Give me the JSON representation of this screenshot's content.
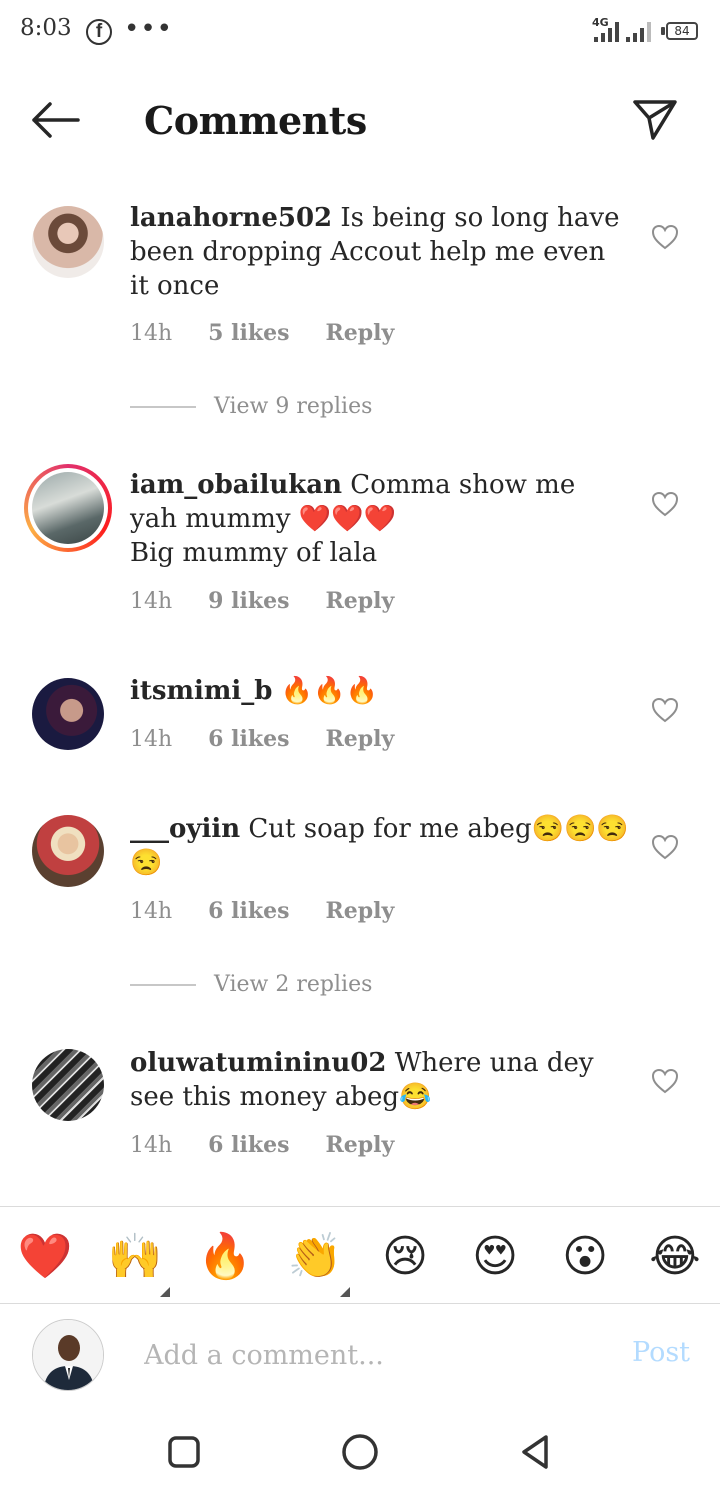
{
  "status_bar": {
    "time": "8:03",
    "network": "4G",
    "battery": "84"
  },
  "header": {
    "title": "Comments"
  },
  "comments": [
    {
      "username": "lanahorne502",
      "text": "Is being so long have been dropping Accout help me even it once",
      "time": "14h",
      "likes": "5 likes",
      "reply": "Reply",
      "view_replies": "View 9 replies"
    },
    {
      "username": "iam_obailukan",
      "text": "Comma show me yah mummy ❤️❤️❤️",
      "text2": "Big mummy of lala",
      "time": "14h",
      "likes": "9 likes",
      "reply": "Reply"
    },
    {
      "username": "itsmimi_b",
      "text": "🔥🔥🔥",
      "time": "14h",
      "likes": "6 likes",
      "reply": "Reply"
    },
    {
      "username": "___oyiin",
      "text": "Cut soap for me abeg😒😒😒😒",
      "time": "14h",
      "likes": "6 likes",
      "reply": "Reply",
      "view_replies": "View 2 replies"
    },
    {
      "username": "oluwatumininu02",
      "text": "Where una dey see this money abeg😂",
      "time": "14h",
      "likes": "6 likes",
      "reply": "Reply"
    }
  ],
  "emoji_bar": [
    "❤️",
    "🙌",
    "🔥",
    "👏",
    "😢",
    "😍",
    "😮",
    "😂"
  ],
  "input": {
    "placeholder": "Add a comment...",
    "post_label": "Post"
  },
  "colors": {
    "text": "#262626",
    "meta": "#8e8e8e",
    "post_disabled": "#b3dbff",
    "story_ring": "#e1306c"
  }
}
